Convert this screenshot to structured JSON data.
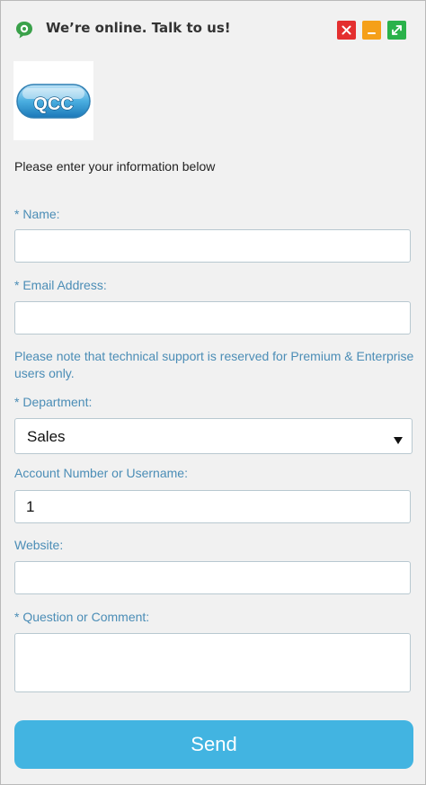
{
  "header": {
    "title": "We’re online. Talk to us!",
    "icons": {
      "chat": "chat-bubble-icon",
      "close": "close-icon",
      "minimize": "minimize-icon",
      "maximize": "expand-icon"
    },
    "colors": {
      "close": "#e42f2f",
      "minimize": "#f5a019",
      "maximize": "#2ab24a"
    }
  },
  "logo": {
    "text": "QCC"
  },
  "form": {
    "intro": "Please enter your information below",
    "name_label": "* Name:",
    "name_value": "",
    "email_label": "* Email Address:",
    "email_value": "",
    "note": "Please note that technical support is reserved for Premium & Enterprise users only.",
    "department_label": "* Department:",
    "department_value": "Sales",
    "account_label": "Account Number or Username:",
    "account_value": "1",
    "website_label": "Website:",
    "website_value": "",
    "question_label": "* Question or Comment:",
    "question_value": "",
    "send_label": "Send"
  },
  "colors": {
    "label": "#4b8db6",
    "send_button": "#42b4e1"
  }
}
